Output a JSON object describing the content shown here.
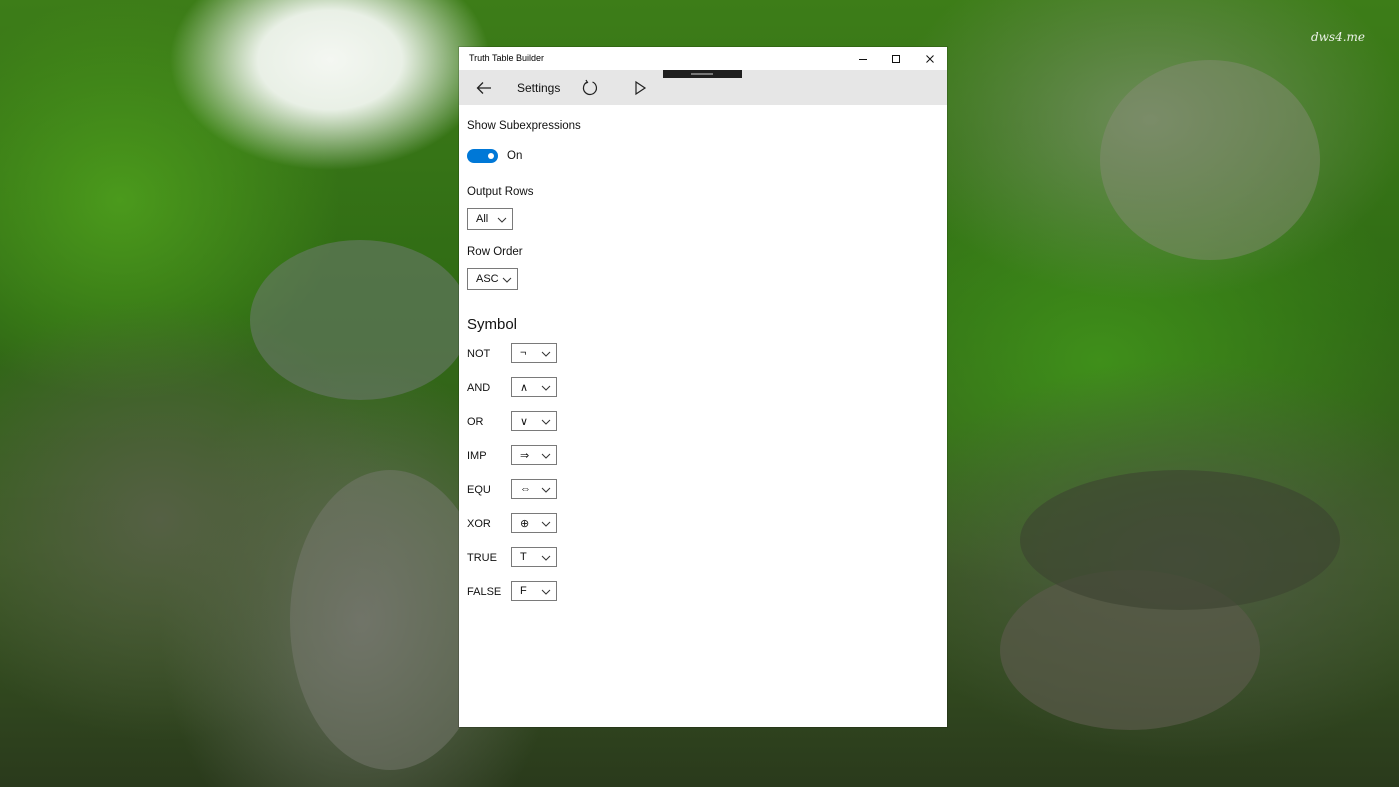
{
  "desktop": {
    "watermark": "dws4.me"
  },
  "window": {
    "title": "Truth Table Builder",
    "controls": {
      "minimize_icon": "minimize-icon",
      "maximize_icon": "maximize-icon",
      "close_icon": "close-icon"
    }
  },
  "command_bar": {
    "back_icon": "back-arrow-icon",
    "title": "Settings",
    "refresh_icon": "refresh-icon",
    "play_icon": "play-icon"
  },
  "settings": {
    "show_subexpressions": {
      "label": "Show Subexpressions",
      "state": "On",
      "enabled": true
    },
    "output_rows": {
      "label": "Output Rows",
      "value": "All"
    },
    "row_order": {
      "label": "Row Order",
      "value": "ASC"
    }
  },
  "symbol": {
    "heading": "Symbol",
    "rows": [
      {
        "label": "NOT",
        "value": "¬"
      },
      {
        "label": "AND",
        "value": "∧"
      },
      {
        "label": "OR",
        "value": "∨"
      },
      {
        "label": "IMP",
        "value": "⇒"
      },
      {
        "label": "EQU",
        "value": "⇔"
      },
      {
        "label": "XOR",
        "value": "⊕"
      },
      {
        "label": "TRUE",
        "value": "T"
      },
      {
        "label": "FALSE",
        "value": "F"
      }
    ]
  },
  "colors": {
    "accent": "#0078d7",
    "command_bar": "#e6e6e6",
    "window_bg": "#ffffff"
  }
}
